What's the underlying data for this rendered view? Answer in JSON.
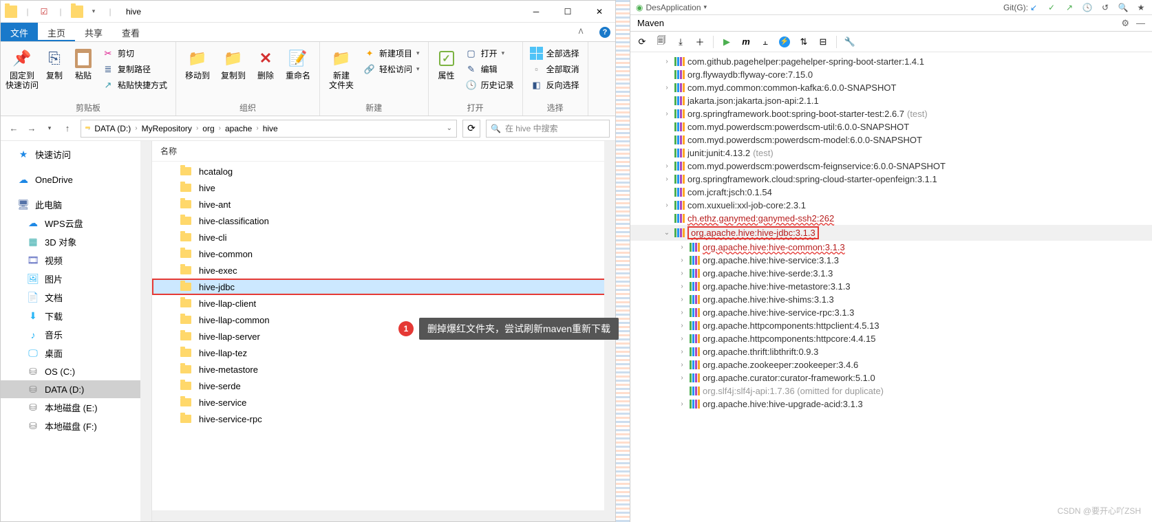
{
  "explorer": {
    "title": "hive",
    "tabs": {
      "file": "文件",
      "home": "主页",
      "share": "共享",
      "view": "查看"
    },
    "ribbon": {
      "clipboard": {
        "pin": "固定到\n快速访问",
        "copy": "复制",
        "paste": "粘贴",
        "cut": "剪切",
        "copy_path": "复制路径",
        "paste_shortcut": "粘贴快捷方式",
        "label": "剪贴板"
      },
      "organize": {
        "moveto": "移动到",
        "copyto": "复制到",
        "delete": "删除",
        "rename": "重命名",
        "label": "组织"
      },
      "new": {
        "newfolder": "新建\n文件夹",
        "newitem": "新建项目",
        "easy_access": "轻松访问",
        "label": "新建"
      },
      "open": {
        "props": "属性",
        "open": "打开",
        "edit": "编辑",
        "history": "历史记录",
        "label": "打开"
      },
      "select": {
        "all": "全部选择",
        "none": "全部取消",
        "invert": "反向选择",
        "label": "选择"
      }
    },
    "breadcrumb": [
      "DATA (D:)",
      "MyRepository",
      "org",
      "apache",
      "hive"
    ],
    "search_placeholder": "在 hive 中搜索",
    "nav": {
      "quick": "快速访问",
      "onedrive": "OneDrive",
      "thispc": "此电脑",
      "wps": "WPS云盘",
      "3d": "3D 对象",
      "videos": "视频",
      "pictures": "图片",
      "documents": "文档",
      "downloads": "下载",
      "music": "音乐",
      "desktop": "桌面",
      "osc": "OS (C:)",
      "datad": "DATA (D:)",
      "diske": "本地磁盘 (E:)",
      "diskf": "本地磁盘 (F:)"
    },
    "file_header": "名称",
    "files": [
      "hcatalog",
      "hive",
      "hive-ant",
      "hive-classification",
      "hive-cli",
      "hive-common",
      "hive-exec",
      "hive-jdbc",
      "hive-llap-client",
      "hive-llap-common",
      "hive-llap-server",
      "hive-llap-tez",
      "hive-metastore",
      "hive-serde",
      "hive-service",
      "hive-service-rpc"
    ],
    "selected_file_index": 7
  },
  "annotation": {
    "number": "1",
    "text": "删掉爆红文件夹，尝试刷新maven重新下载"
  },
  "ide": {
    "topright_run": "DesApplication",
    "topright_git": "Git(G):",
    "maven_title": "Maven",
    "tree": [
      {
        "indent": 1,
        "chev": ">",
        "text": "com.github.pagehelper:pagehelper-spring-boot-starter:1.4.1"
      },
      {
        "indent": 1,
        "chev": "",
        "text": "org.flywaydb:flyway-core:7.15.0"
      },
      {
        "indent": 1,
        "chev": ">",
        "text": "com.myd.common:common-kafka:6.0.0-SNAPSHOT"
      },
      {
        "indent": 1,
        "chev": "",
        "text": "jakarta.json:jakarta.json-api:2.1.1"
      },
      {
        "indent": 1,
        "chev": ">",
        "text": "org.springframework.boot:spring-boot-starter-test:2.6.7",
        "suffix": "(test)"
      },
      {
        "indent": 1,
        "chev": "",
        "text": "com.myd.powerdscm:powerdscm-util:6.0.0-SNAPSHOT"
      },
      {
        "indent": 1,
        "chev": "",
        "text": "com.myd.powerdscm:powerdscm-model:6.0.0-SNAPSHOT"
      },
      {
        "indent": 1,
        "chev": "",
        "text": "junit:junit:4.13.2",
        "suffix": "(test)"
      },
      {
        "indent": 1,
        "chev": ">",
        "text": "com.myd.powerdscm:powerdscm-feignservice:6.0.0-SNAPSHOT"
      },
      {
        "indent": 1,
        "chev": ">",
        "text": "org.springframework.cloud:spring-cloud-starter-openfeign:3.1.1"
      },
      {
        "indent": 1,
        "chev": "",
        "text": "com.jcraft:jsch:0.1.54"
      },
      {
        "indent": 1,
        "chev": ">",
        "text": "com.xuxueli:xxl-job-core:2.3.1"
      },
      {
        "indent": 1,
        "chev": "",
        "text": "ch.ethz.ganymed:ganymed-ssh2:262",
        "err": true
      },
      {
        "indent": 1,
        "chev": "v",
        "text": "org.apache.hive:hive-jdbc:3.1.3",
        "err": true,
        "boxed": true,
        "sel": true
      },
      {
        "indent": 2,
        "chev": ">",
        "text": "org.apache.hive:hive-common:3.1.3",
        "err": true
      },
      {
        "indent": 2,
        "chev": ">",
        "text": "org.apache.hive:hive-service:3.1.3"
      },
      {
        "indent": 2,
        "chev": ">",
        "text": "org.apache.hive:hive-serde:3.1.3"
      },
      {
        "indent": 2,
        "chev": ">",
        "text": "org.apache.hive:hive-metastore:3.1.3"
      },
      {
        "indent": 2,
        "chev": ">",
        "text": "org.apache.hive:hive-shims:3.1.3"
      },
      {
        "indent": 2,
        "chev": ">",
        "text": "org.apache.hive:hive-service-rpc:3.1.3"
      },
      {
        "indent": 2,
        "chev": ">",
        "text": "org.apache.httpcomponents:httpclient:4.5.13"
      },
      {
        "indent": 2,
        "chev": ">",
        "text": "org.apache.httpcomponents:httpcore:4.4.15"
      },
      {
        "indent": 2,
        "chev": ">",
        "text": "org.apache.thrift:libthrift:0.9.3"
      },
      {
        "indent": 2,
        "chev": ">",
        "text": "org.apache.zookeeper:zookeeper:3.4.6"
      },
      {
        "indent": 2,
        "chev": ">",
        "text": "org.apache.curator:curator-framework:5.1.0"
      },
      {
        "indent": 2,
        "chev": "",
        "text": "org.slf4j:slf4j-api:1.7.36 (omitted for duplicate)",
        "dim": true
      },
      {
        "indent": 2,
        "chev": ">",
        "text": "org.apache.hive:hive-upgrade-acid:3.1.3"
      }
    ]
  },
  "watermark": "CSDN @要开心吖ZSH"
}
